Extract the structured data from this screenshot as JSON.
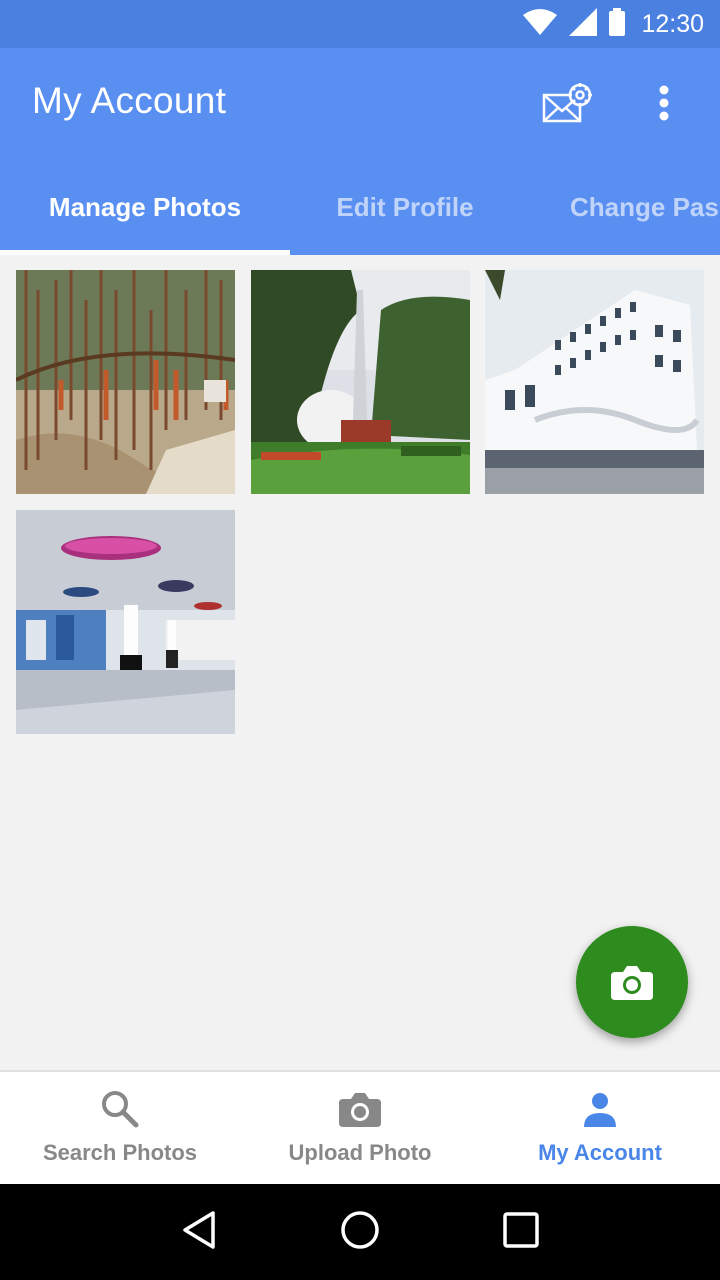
{
  "status_bar": {
    "time": "12:30",
    "icons": [
      "wifi-icon",
      "signal-icon",
      "battery-icon"
    ]
  },
  "app_bar": {
    "title": "My Account",
    "actions": [
      "mail-settings-icon",
      "more-vert-icon"
    ]
  },
  "tabs": [
    {
      "label": "Manage Photos",
      "active": true
    },
    {
      "label": "Edit Profile",
      "active": false
    },
    {
      "label": "Change Pas",
      "active": false
    }
  ],
  "photos": [
    {
      "subject": "banyan trees"
    },
    {
      "subject": "garden with dome and tower"
    },
    {
      "subject": "white building"
    },
    {
      "subject": "hall interior"
    }
  ],
  "fab": {
    "icon": "camera-icon"
  },
  "bottom_nav": [
    {
      "label": "Search Photos",
      "icon": "search-icon",
      "active": false
    },
    {
      "label": "Upload Photo",
      "icon": "camera-icon",
      "active": false
    },
    {
      "label": "My Account",
      "icon": "person-icon",
      "active": true
    }
  ],
  "system_nav": [
    "back-icon",
    "home-icon",
    "recents-icon"
  ],
  "colors": {
    "status_bar": "#4a80e0",
    "app_bar": "#5a8ff2",
    "accent": "#4a86e8",
    "fab": "#2e8b1e",
    "background": "#f2f2f2"
  }
}
